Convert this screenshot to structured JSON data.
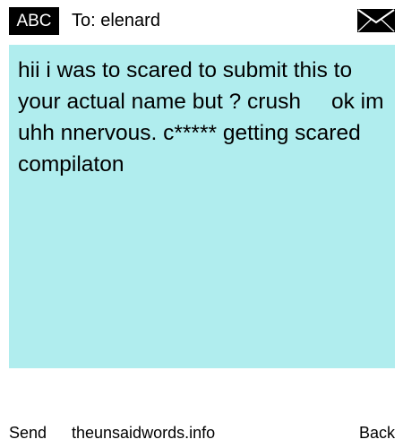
{
  "header": {
    "mode_label": "ABC",
    "to_line": "To: elenard",
    "envelope_icon": "envelope-icon"
  },
  "message": {
    "text": "hii i was to scared to submit this to your actual name but ? crush     ok im    uhh nnervous. c***** getting scared compilaton",
    "background_color": "#b0edee"
  },
  "footer": {
    "left_softkey": "Send",
    "site": "theunsaidwords.info",
    "right_softkey": "Back"
  }
}
